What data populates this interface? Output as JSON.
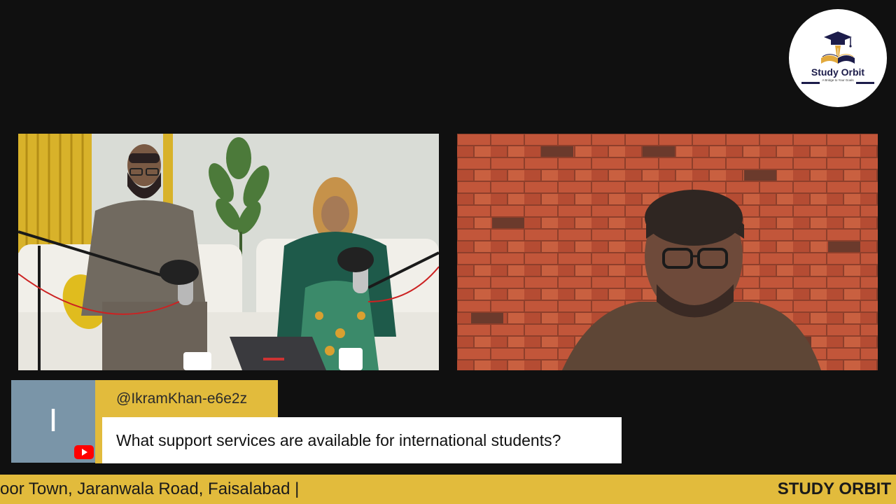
{
  "logo": {
    "brand_text": "Study Orbit",
    "tagline": "A Bridge to Your Goals"
  },
  "left_video": {
    "scene": "podcast-studio"
  },
  "right_video": {
    "scene": "guest-brick-wall"
  },
  "comment": {
    "avatar_letter": "I",
    "author": "@IkramKhan-e6e2z",
    "text": "What support services are available for international students?",
    "platform_icon": "youtube-icon"
  },
  "ticker": {
    "scrolling_text": "oor Town, Jaranwala Road, Faisalabad |",
    "brand": "STUDY ORBIT"
  },
  "colors": {
    "accent_yellow": "#e2bb3c",
    "background": "#101010",
    "avatar_bg": "#7a95a8",
    "youtube_red": "#ff0000",
    "logo_navy": "#1c1c4a"
  }
}
